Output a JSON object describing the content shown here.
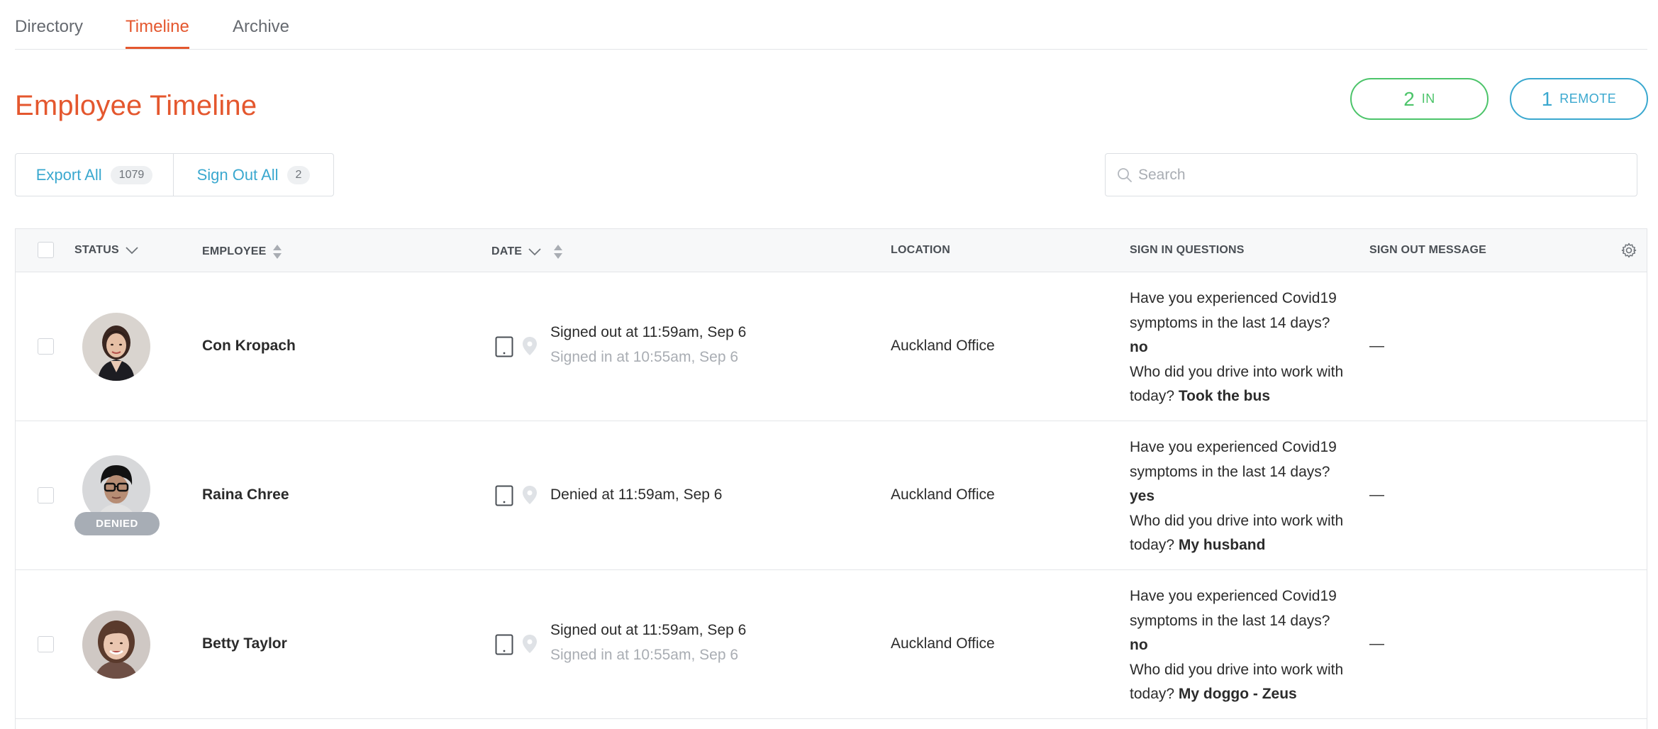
{
  "tabs": [
    {
      "label": "Directory",
      "active": false
    },
    {
      "label": "Timeline",
      "active": true
    },
    {
      "label": "Archive",
      "active": false
    }
  ],
  "page_title": "Employee Timeline",
  "counters": {
    "in": {
      "count": "2",
      "label": "IN",
      "color": "#4cc46a"
    },
    "remote": {
      "count": "1",
      "label": "REMOTE",
      "color": "#3aa8cf"
    }
  },
  "actions": {
    "export": {
      "label": "Export All",
      "count": "1079"
    },
    "signout": {
      "label": "Sign Out All",
      "count": "2"
    }
  },
  "search": {
    "placeholder": "Search",
    "value": ""
  },
  "table": {
    "headers": {
      "status": "STATUS",
      "employee": "EMPLOYEE",
      "date": "DATE",
      "location": "LOCATION",
      "questions": "SIGN IN QUESTIONS",
      "signout": "SIGN OUT MESSAGE"
    },
    "rows": [
      {
        "name": "Con Kropach",
        "status_badge": "",
        "date_main": "Signed out at 11:59am, Sep 6",
        "date_sub": "Signed in at 10:55am, Sep 6",
        "location": "Auckland Office",
        "q1": "Have you experienced Covid19 symptoms in the last 14 days?",
        "a1": "no",
        "q2": "Who did you drive into work with today?",
        "a2": "Took the bus",
        "signout_message": "—"
      },
      {
        "name": "Raina Chree",
        "status_badge": "DENIED",
        "date_main": "Denied at 11:59am, Sep 6",
        "date_sub": "",
        "location": "Auckland Office",
        "q1": "Have you experienced Covid19 symptoms in the last 14 days?",
        "a1": "yes",
        "q2": "Who did you drive into work with today?",
        "a2": "My husband",
        "signout_message": "—"
      },
      {
        "name": "Betty Taylor",
        "status_badge": "",
        "date_main": "Signed out at 11:59am, Sep 6",
        "date_sub": "Signed in at 10:55am, Sep 6",
        "location": "Auckland Office",
        "q1": "Have you experienced Covid19 symptoms in the last 14 days?",
        "a1": "no",
        "q2": "Who did you drive into work with today?",
        "a2": "My doggo - Zeus",
        "signout_message": "—"
      }
    ]
  },
  "colors": {
    "accent": "#e4572e",
    "link": "#3aa8cf",
    "in": "#4cc46a",
    "border": "#e3e5e8"
  }
}
